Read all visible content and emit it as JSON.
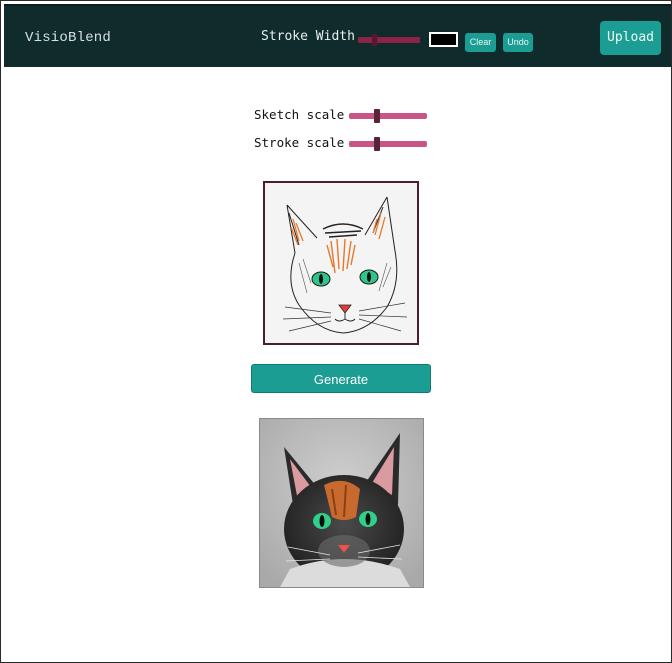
{
  "app": {
    "title": "VisioBlend"
  },
  "toolbar": {
    "stroke_width_label": "Stroke Width",
    "stroke_width_value": 0.25,
    "stroke_color": "#000000",
    "clear_label": "Clear",
    "undo_label": "Undo",
    "upload_label": "Upload"
  },
  "controls": {
    "sketch_scale_label": "Sketch scale",
    "sketch_scale_value": 0.35,
    "stroke_scale_label": "Stroke scale",
    "stroke_scale_value": 0.35
  },
  "canvas": {
    "generate_label": "Generate"
  },
  "colors": {
    "header_bg": "#0f2b2b",
    "accent": "#1b9d93",
    "slider": "#c95486"
  }
}
